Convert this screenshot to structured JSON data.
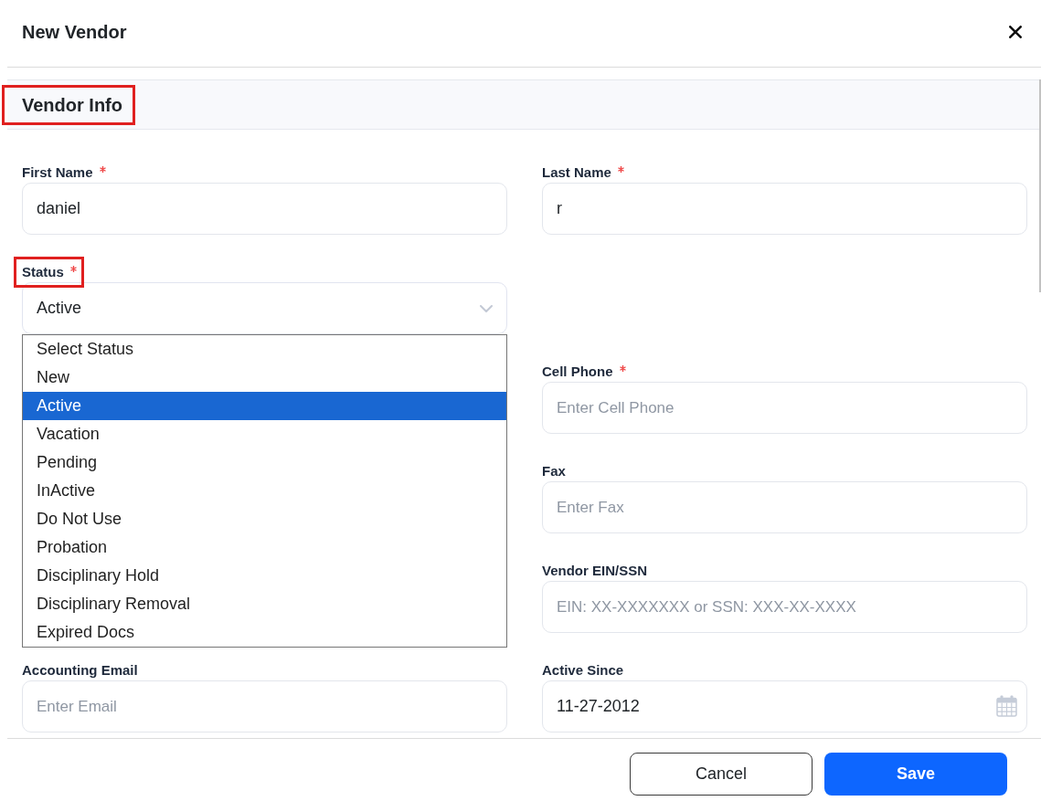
{
  "window": {
    "title": "New Vendor"
  },
  "section": {
    "title": "Vendor Info",
    "highlighted": true
  },
  "rows": [
    {
      "left": {
        "label": "First Name",
        "required": true,
        "highlighted": false,
        "kind": "text",
        "value": "daniel"
      },
      "right": {
        "label": "Last Name",
        "required": true,
        "highlighted": false,
        "kind": "text",
        "value": "r"
      }
    },
    {
      "left": {
        "label": "Status",
        "required": true,
        "highlighted": true,
        "kind": "select",
        "value": "Active",
        "expanded": true,
        "options": [
          {
            "label": "Select Status",
            "selected": false
          },
          {
            "label": "New",
            "selected": false
          },
          {
            "label": "Active",
            "selected": true
          },
          {
            "label": "Vacation",
            "selected": false
          },
          {
            "label": "Pending",
            "selected": false
          },
          {
            "label": "InActive",
            "selected": false
          },
          {
            "label": "Do Not Use",
            "selected": false
          },
          {
            "label": "Probation",
            "selected": false
          },
          {
            "label": "Disciplinary Hold",
            "selected": false
          },
          {
            "label": "Disciplinary Removal",
            "selected": false
          },
          {
            "label": "Expired Docs",
            "selected": false
          }
        ]
      }
    },
    {
      "right": {
        "label": "Cell Phone",
        "required": true,
        "highlighted": false,
        "kind": "text",
        "placeholder": "Enter Cell Phone"
      }
    },
    {
      "right": {
        "label": "Fax",
        "required": false,
        "highlighted": false,
        "kind": "text",
        "placeholder": "Enter Fax"
      }
    },
    {
      "right": {
        "label": "Vendor EIN/SSN",
        "required": false,
        "highlighted": false,
        "kind": "text",
        "placeholder": "EIN: XX-XXXXXXX or SSN: XXX-XX-XXXX"
      }
    },
    {
      "left": {
        "label": "Accounting Email",
        "required": false,
        "highlighted": false,
        "kind": "text",
        "placeholder": "Enter Email"
      },
      "right": {
        "label": "Active Since",
        "required": false,
        "highlighted": false,
        "kind": "date",
        "value": "11-27-2012"
      }
    }
  ],
  "buttons": [
    {
      "label": "Cancel",
      "kind": "secondary"
    },
    {
      "label": "Save",
      "kind": "primary"
    }
  ]
}
